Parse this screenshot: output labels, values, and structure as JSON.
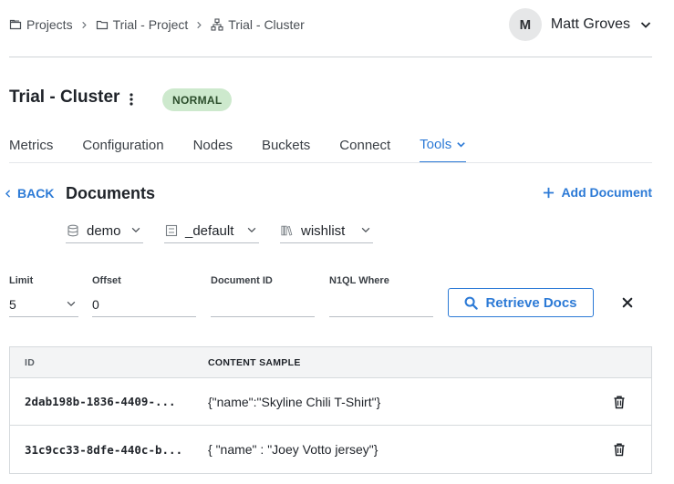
{
  "breadcrumb": {
    "items": [
      {
        "label": "Projects",
        "icon": "projects-icon"
      },
      {
        "label": "Trial - Project",
        "icon": "folder-icon"
      },
      {
        "label": "Trial - Cluster",
        "icon": "cluster-icon"
      }
    ]
  },
  "user": {
    "initial": "M",
    "name": "Matt Groves"
  },
  "cluster": {
    "title": "Trial - Cluster",
    "status": "NORMAL",
    "status_color": "#cde9cd"
  },
  "tabs": [
    {
      "label": "Metrics"
    },
    {
      "label": "Configuration"
    },
    {
      "label": "Nodes"
    },
    {
      "label": "Buckets"
    },
    {
      "label": "Connect"
    },
    {
      "label": "Tools",
      "active": true
    }
  ],
  "documents": {
    "back_label": "BACK",
    "title": "Documents",
    "add_label": "Add Document",
    "bucket": "demo",
    "scope": "_default",
    "collection": "wishlist"
  },
  "query": {
    "limit_label": "Limit",
    "limit_value": "5",
    "offset_label": "Offset",
    "offset_value": "0",
    "docid_label": "Document ID",
    "docid_value": "",
    "where_label": "N1QL Where",
    "where_value": "",
    "retrieve_label": "Retrieve Docs"
  },
  "table": {
    "headers": {
      "id": "ID",
      "content": "CONTENT SAMPLE"
    },
    "rows": [
      {
        "id": "2dab198b-1836-4409-...",
        "content": "{\"name\":\"Skyline Chili T-Shirt\"}"
      },
      {
        "id": "31c9cc33-8dfe-440c-b...",
        "content": "{ \"name\" : \"Joey Votto jersey\"}"
      }
    ]
  },
  "colors": {
    "accent": "#2c7ad6",
    "badge_bg": "#cde9cd"
  }
}
